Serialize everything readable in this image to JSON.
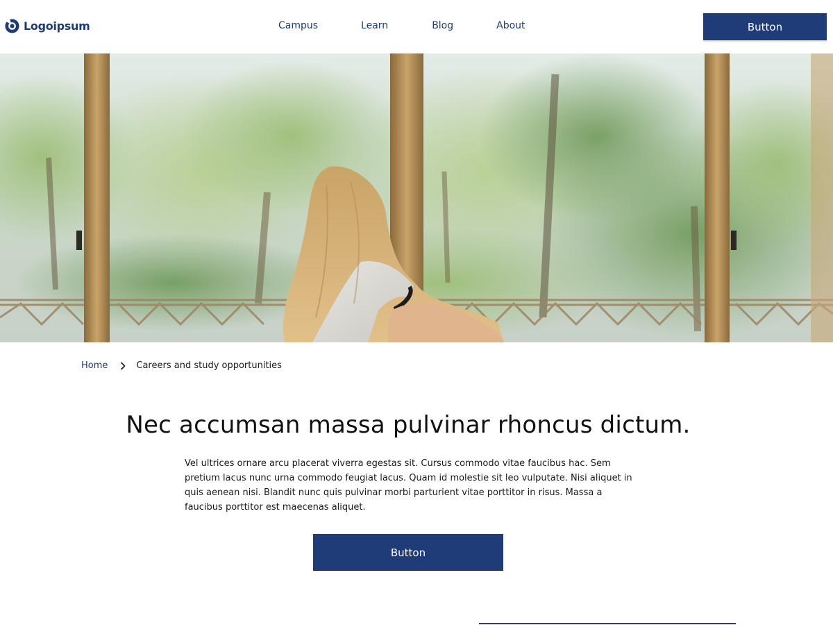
{
  "header": {
    "logo_text": "Logoipsum",
    "nav": [
      {
        "label": "Campus"
      },
      {
        "label": "Learn"
      },
      {
        "label": "Blog"
      },
      {
        "label": "About"
      }
    ],
    "button_label": "Button"
  },
  "hero": {
    "image_subject": "woman-by-window"
  },
  "breadcrumb": {
    "home": "Home",
    "current": "Careers and study opportunities"
  },
  "content": {
    "headline": "Nec accumsan massa pulvinar rhoncus dictum.",
    "body": "Vel ultrices ornare arcu placerat viverra egestas sit. Cursus commodo vitae faucibus hac. Sem pretium lacus nunc urna commodo feugiat lacus. Quam id molestie sit leo vulputate. Nisi aliquet in quis aenean nisi. Blandit nunc quis pulvinar morbi parturient vitae porttitor in risus. Massa a faucibus porttitor est maecenas aliquet.",
    "button_label": "Button"
  },
  "colors": {
    "brand": "#1f3b78",
    "nav_text": "#1f3b73"
  },
  "icons": {
    "logo": "logo-mark-icon",
    "breadcrumb_separator": "chevron-right-icon"
  }
}
